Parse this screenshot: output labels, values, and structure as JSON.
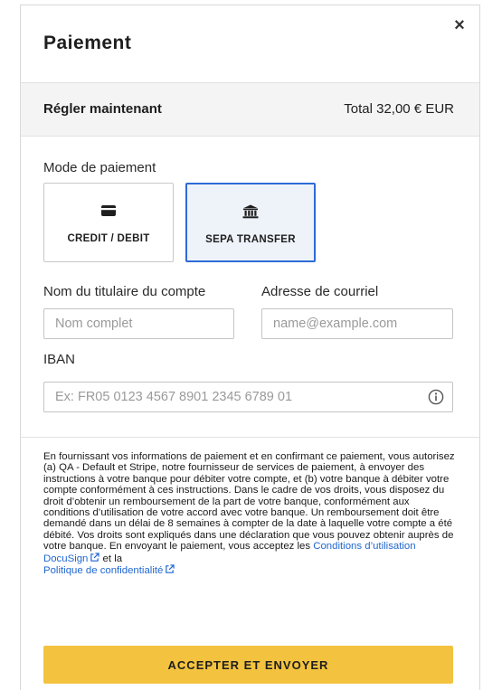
{
  "dialog": {
    "title": "Paiement",
    "close_symbol": "×"
  },
  "summary": {
    "action_label": "Régler maintenant",
    "total_label": "Total 32,00 € EUR"
  },
  "payment_method": {
    "label": "Mode de paiement",
    "options": [
      {
        "label": "CREDIT / DEBIT",
        "icon": "credit-card-icon",
        "selected": false
      },
      {
        "label": "SEPA TRANSFER",
        "icon": "bank-icon",
        "selected": true
      }
    ],
    "accent_color": "#2e6bd6"
  },
  "form": {
    "account_holder": {
      "label": "Nom du titulaire du compte",
      "placeholder": "Nom complet",
      "value": ""
    },
    "email": {
      "label": "Adresse de courriel",
      "placeholder": "name@example.com",
      "value": ""
    },
    "iban": {
      "label": "IBAN",
      "placeholder": "Ex: FR05 0123 4567 8901 2345 6789 01",
      "value": "",
      "icon": "info-icon"
    }
  },
  "legal": {
    "text": "En fournissant vos informations de paiement et en confirmant ce paiement, vous autorisez (a) QA - Default et Stripe, notre fournisseur de services de paiement, à envoyer des instructions à votre banque pour débiter votre compte, et (b) votre banque à débiter votre compte conformément à ces instructions. Dans le cadre de vos droits, vous disposez du droit d’obtenir un remboursement de la part de votre banque, conformément aux conditions d’utilisation de votre accord avec votre banque. Un remboursement doit être demandé dans un délai de 8 semaines à compter de la date à laquelle votre compte a été débité. Vos droits sont expliqués dans une déclaration que vous pouvez obtenir auprès de votre banque. En envoyant le paiement, vous acceptez les ",
    "terms_link": "Conditions d’utilisation DocuSign",
    "connector": " et la",
    "privacy_link": "Politique de confidentialité",
    "link_color": "#1f66d1"
  },
  "submit": {
    "label": "ACCEPTER ET ENVOYER",
    "color": "#f3c33f"
  }
}
